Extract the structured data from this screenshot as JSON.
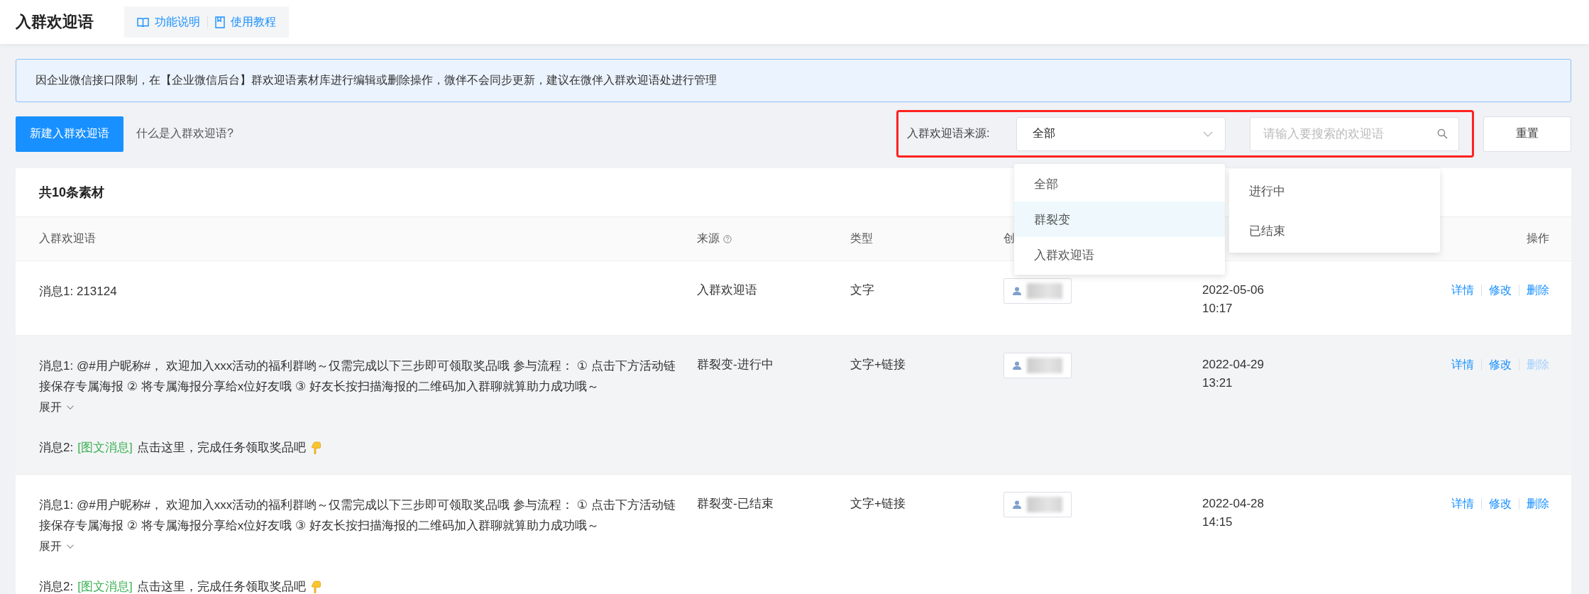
{
  "header": {
    "title": "入群欢迎语",
    "links": [
      {
        "kind": "guide",
        "label": "功能说明"
      },
      {
        "kind": "tutorial",
        "label": "使用教程"
      }
    ]
  },
  "notice": "因企业微信接口限制，在【企业微信后台】群欢迎语素材库进行编辑或删除操作，微伴不会同步更新，建议在微伴入群欢迎语处进行管理",
  "toolbar": {
    "create_button": "新建入群欢迎语",
    "help_link": "什么是入群欢迎语?",
    "source_filter": {
      "label": "入群欢迎语来源:",
      "value": "全部",
      "options": [
        {
          "label": "全部",
          "highlighted": false
        },
        {
          "label": "群裂变",
          "highlighted": true
        },
        {
          "label": "入群欢迎语",
          "highlighted": false
        }
      ],
      "submenu": [
        {
          "label": "进行中",
          "highlighted": false
        },
        {
          "label": "已结束",
          "highlighted": false
        }
      ]
    },
    "search": {
      "placeholder": "请输入要搜索的欢迎语"
    },
    "reset_button": "重置"
  },
  "table": {
    "title": "共10条素材",
    "columns": [
      {
        "label": "入群欢迎语"
      },
      {
        "label": "来源",
        "help": true
      },
      {
        "label": "类型"
      },
      {
        "label": "创"
      }
    ],
    "actions_header": "操作",
    "rows": [
      {
        "hovered": false,
        "messages": [
          {
            "kind": "text",
            "text": "消息1: 213124"
          }
        ],
        "source": "入群欢迎语",
        "type": "文字",
        "date": "2022-05-06",
        "time": "10:17",
        "actions": [
          {
            "label": "详情",
            "disabled": false
          },
          {
            "label": "修改",
            "disabled": false
          },
          {
            "label": "删除",
            "disabled": false
          }
        ]
      },
      {
        "hovered": true,
        "messages": [
          {
            "kind": "text",
            "text": "消息1: @#用户昵称#， 欢迎加入xxx活动的福利群哟～仅需完成以下三步即可领取奖品哦 参与流程： ① 点击下方活动链接保存专属海报 ② 将专属海报分享给x位好友哦 ③ 好友长按扫描海报的二维码加入群聊就算助力成功哦～",
            "toggle": "展开"
          },
          {
            "kind": "media",
            "label": "消息2:",
            "tag": "[图文消息]",
            "text": "点击这里，完成任务领取奖品吧"
          }
        ],
        "source": "群裂变-进行中",
        "type": "文字+链接",
        "date": "2022-04-29",
        "time": "13:21",
        "actions": [
          {
            "label": "详情",
            "disabled": false
          },
          {
            "label": "修改",
            "disabled": false
          },
          {
            "label": "删除",
            "disabled": true
          }
        ]
      },
      {
        "hovered": false,
        "messages": [
          {
            "kind": "text",
            "text": "消息1: @#用户昵称#， 欢迎加入xxx活动的福利群哟～仅需完成以下三步即可领取奖品哦 参与流程： ① 点击下方活动链接保存专属海报 ② 将专属海报分享给x位好友哦 ③ 好友长按扫描海报的二维码加入群聊就算助力成功哦～",
            "toggle": "展开"
          },
          {
            "kind": "media",
            "label": "消息2:",
            "tag": "[图文消息]",
            "text": "点击这里，完成任务领取奖品吧"
          }
        ],
        "source": "群裂变-已结束",
        "type": "文字+链接",
        "date": "2022-04-28",
        "time": "14:15",
        "actions": [
          {
            "label": "详情",
            "disabled": false
          },
          {
            "label": "修改",
            "disabled": false
          },
          {
            "label": "删除",
            "disabled": false
          }
        ]
      }
    ]
  }
}
